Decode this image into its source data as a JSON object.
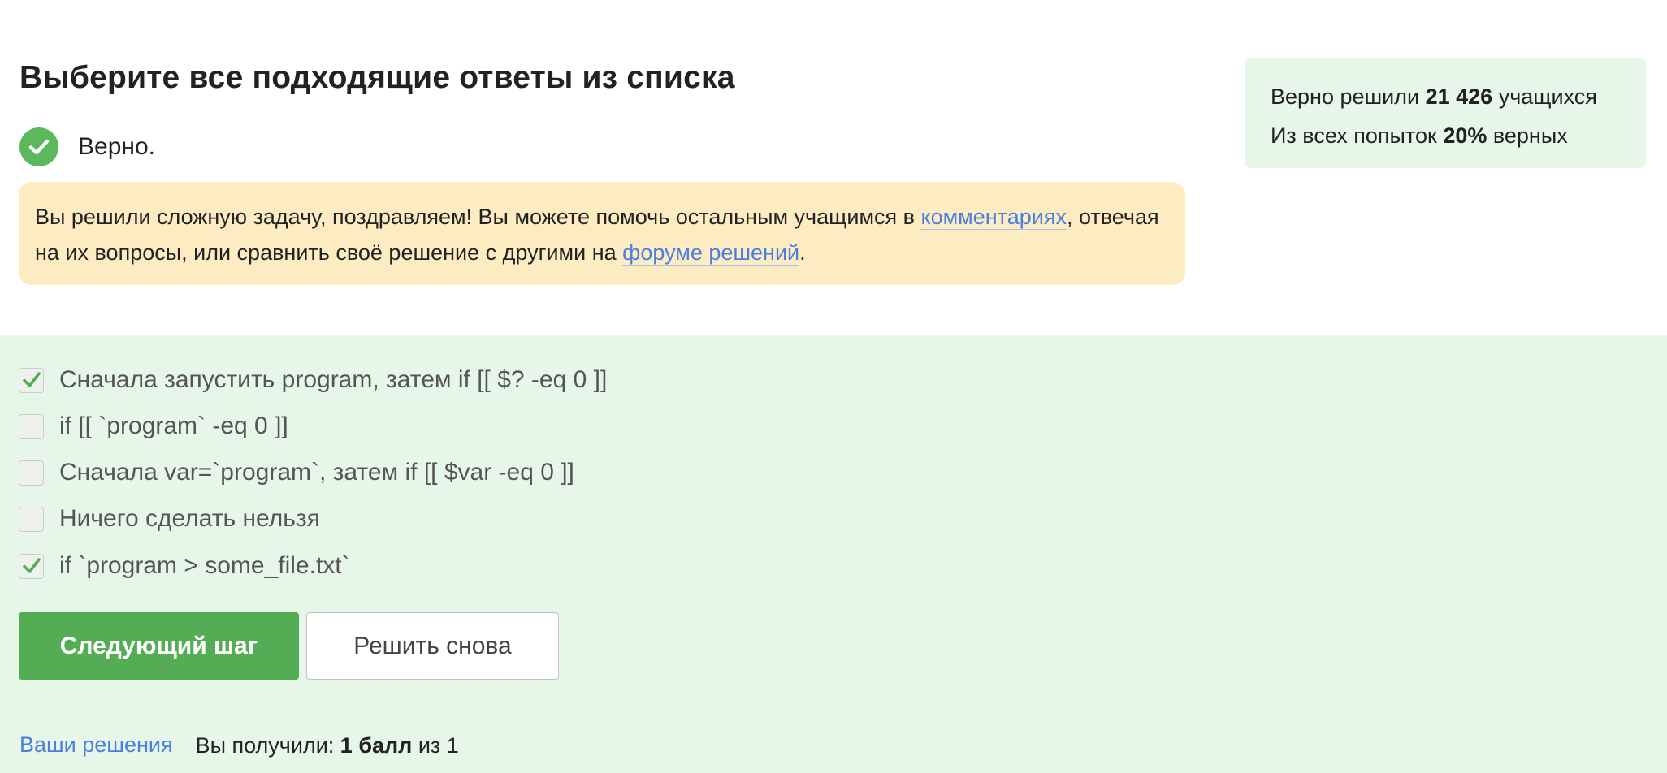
{
  "task": {
    "title": "Выберите все подходящие ответы из списка"
  },
  "status": {
    "icon": "check-circle-icon",
    "text": "Верно.",
    "color": "#5cb85c"
  },
  "notice": {
    "text_before": "Вы решили сложную задачу, поздравляем! Вы можете помочь остальным учащимся в ",
    "link_comments": "комментариях",
    "text_middle": ", отвечая на их вопросы, или сравнить своё решение с другими на ",
    "link_forum": "форуме решений",
    "text_after": "."
  },
  "stats": {
    "solved_prefix": "Верно решили ",
    "solved_count": "21 426",
    "solved_suffix": " учащихся",
    "attempts_prefix": "Из всех попыток ",
    "attempts_percent": "20%",
    "attempts_suffix": " верных"
  },
  "options": [
    {
      "label": "Сначала запустить program, затем if [[ $? -eq 0 ]]",
      "checked": true
    },
    {
      "label": "if [[ `program` -eq 0 ]]",
      "checked": false
    },
    {
      "label": "Сначала var=`program`, затем if [[ $var -eq 0 ]]",
      "checked": false
    },
    {
      "label": "Ничего сделать нельзя",
      "checked": false
    },
    {
      "label": "if `program > some_file.txt`",
      "checked": true
    }
  ],
  "buttons": {
    "next": "Следующий шаг",
    "retry": "Решить снова"
  },
  "footer": {
    "solutions_link": "Ваши решения",
    "score_prefix": "Вы получили: ",
    "score_value": "1 балл",
    "score_suffix": " из 1"
  },
  "colors": {
    "accent_green": "#54ad54",
    "answer_bg": "#e6f6e9",
    "notice_bg": "#fdebc2",
    "link": "#4a7ee0"
  }
}
